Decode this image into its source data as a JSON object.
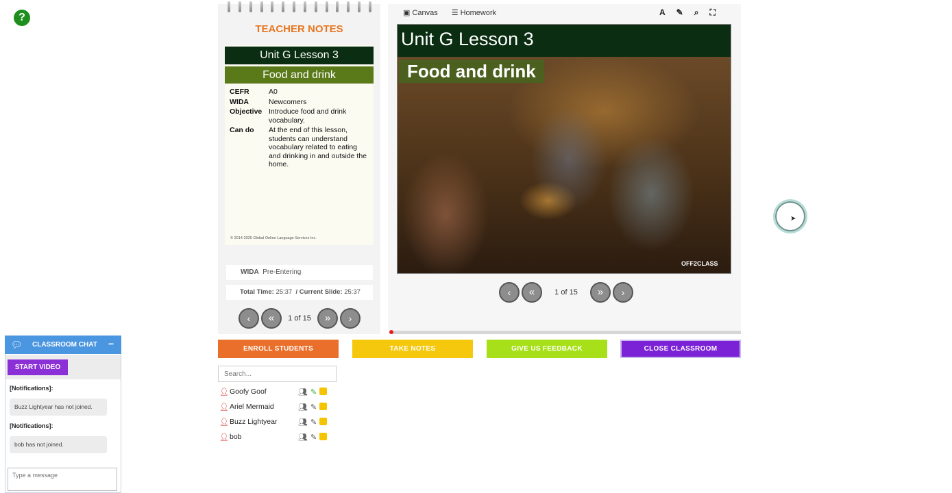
{
  "help": {
    "icon": "question-icon",
    "glyph": "?"
  },
  "teacher_notes": {
    "title": "TEACHER NOTES",
    "unit": "Unit G Lesson 3",
    "topic": "Food and drink",
    "fields": [
      {
        "key": "CEFR",
        "value": "A0"
      },
      {
        "key": "WIDA",
        "value": "Newcomers"
      },
      {
        "key": "Objective",
        "value": "Introduce food and drink vocabulary."
      },
      {
        "key": "Can do",
        "value": "At the end of this lesson, students can understand vocabulary related to eating and drinking in and outside the home."
      }
    ],
    "copyright": "© 2014-2025 Global Online Language Services Inc.",
    "wida_label": "WIDA",
    "wida_value": "Pre-Entering",
    "total_time_label": "Total Time:",
    "total_time": "25:37",
    "current_slide_label": "/ Current Slide:",
    "current_slide": "25:37",
    "pager": {
      "counter": "1 of 15"
    }
  },
  "canvas": {
    "tabs": [
      {
        "icon": "image-icon",
        "label": "Canvas"
      },
      {
        "icon": "list-icon",
        "label": "Homework"
      }
    ],
    "tools": [
      "text-icon",
      "pencil-icon",
      "search-icon",
      "fullscreen-icon"
    ],
    "slide_title": "Unit G Lesson 3",
    "slide_subtitle": "Food and drink",
    "brand": "OFF2CLASS",
    "pager": {
      "counter": "1 of 15"
    },
    "progress": 0.0
  },
  "actions": {
    "enroll": "ENROLL STUDENTS",
    "take_notes": "TAKE NOTES",
    "feedback": "GIVE US FEEDBACK",
    "close": "CLOSE CLASSROOM"
  },
  "students": {
    "search_placeholder": "Search...",
    "list": [
      {
        "name": "Goofy Goof",
        "pencil_active": true
      },
      {
        "name": "Ariel Mermaid",
        "pencil_active": false
      },
      {
        "name": "Buzz Lightyear",
        "pencil_active": false
      },
      {
        "name": "bob",
        "pencil_active": false
      }
    ]
  },
  "chat": {
    "title": "CLASSROOM CHAT",
    "minimize": "−",
    "start_video": "START VIDEO",
    "notifications": [
      {
        "label": "[Notifications]:",
        "text": "Buzz Lightyear has not joined."
      },
      {
        "label": "[Notifications]:",
        "text": "bob has not joined."
      }
    ],
    "input_placeholder": "Type a message"
  },
  "colors": {
    "accent_orange": "#ea6f2a",
    "accent_yellow": "#f5c80d",
    "accent_green": "#a7e018",
    "accent_purple": "#7b22d6",
    "chat_blue": "#4b96e0",
    "slide_dark": "#0b2e12"
  }
}
